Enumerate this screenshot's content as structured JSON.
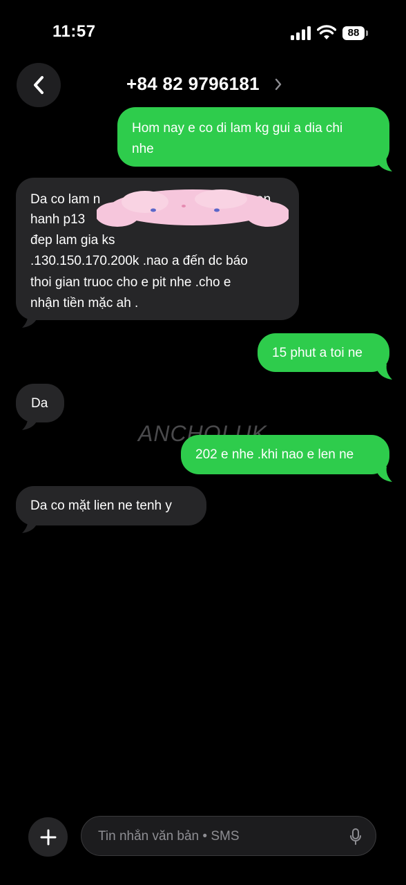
{
  "status_bar": {
    "time": "11:57",
    "battery": "88"
  },
  "header": {
    "contact": "+84 82 9796181"
  },
  "messages": [
    {
      "direction": "outgoing",
      "lines": [
        "Hom nay e co di lam kg gui a dia chi",
        "nhe"
      ]
    },
    {
      "direction": "incoming",
      "lines": [
        "Da co lam n",
        "hanh p13",
        "đep lam gia ks",
        ".130.150.170.200k .nao a đến  dc báo",
        "thoi gian truoc cho e pit nhe .cho e",
        "nhận tiền mặc ah ."
      ],
      "line_tails": [
        "an"
      ]
    },
    {
      "direction": "outgoing",
      "lines": [
        "15 phut a toi ne"
      ]
    },
    {
      "direction": "incoming",
      "lines": [
        "Da"
      ]
    },
    {
      "direction": "outgoing",
      "lines": [
        "202 e nhe .khi nao e len ne"
      ]
    },
    {
      "direction": "incoming",
      "lines": [
        "Da co mặt lien ne tenh y"
      ]
    }
  ],
  "watermark": "ANCHOI.UK",
  "composer": {
    "placeholder": "Tin nhắn văn bản • SMS"
  },
  "colors": {
    "outgoing": "#2ecc4c",
    "incoming": "#262628",
    "background": "#000000"
  },
  "icons": {
    "back": "chevron-left-icon",
    "add": "plus-icon",
    "mic": "mic-icon",
    "title_chevron": "chevron-right-icon"
  }
}
